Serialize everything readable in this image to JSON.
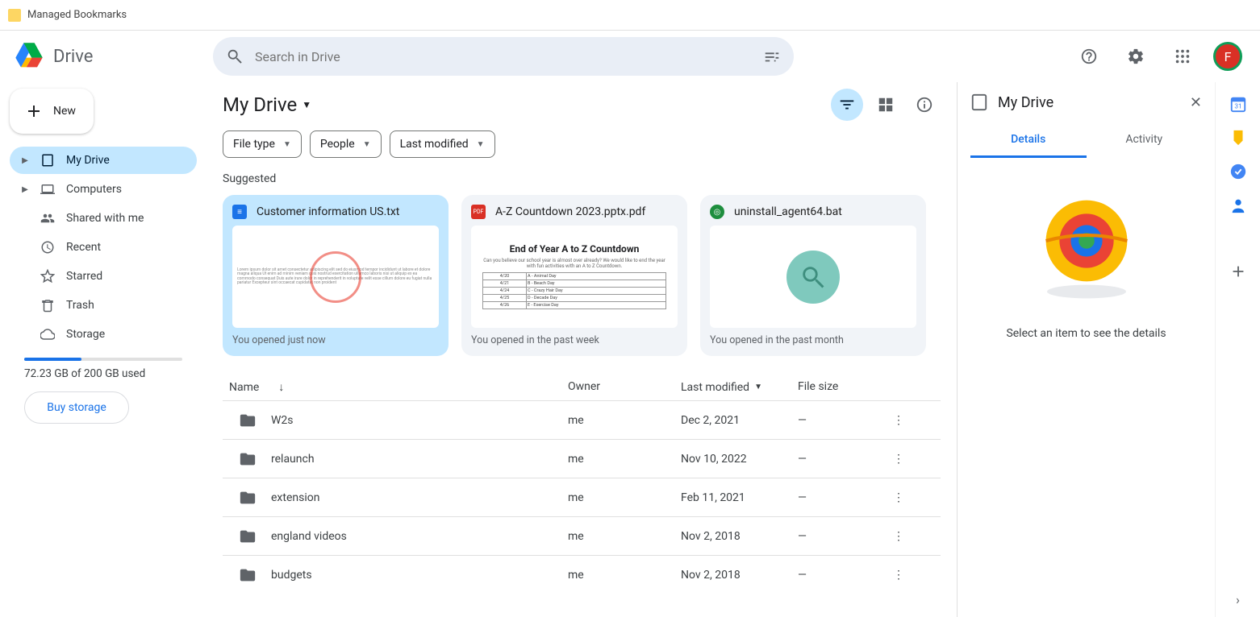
{
  "bookmark_bar": {
    "label": "Managed Bookmarks"
  },
  "app": {
    "name": "Drive"
  },
  "search": {
    "placeholder": "Search in Drive"
  },
  "avatar": {
    "letter": "F"
  },
  "sidebar": {
    "new_label": "New",
    "items": [
      {
        "label": "My Drive",
        "expandable": true
      },
      {
        "label": "Computers",
        "expandable": true
      },
      {
        "label": "Shared with me"
      },
      {
        "label": "Recent"
      },
      {
        "label": "Starred"
      },
      {
        "label": "Trash"
      },
      {
        "label": "Storage"
      }
    ],
    "storage_used_text": "72.23 GB of 200 GB used",
    "storage_pct": 36,
    "buy_label": "Buy storage"
  },
  "breadcrumb": {
    "title": "My Drive"
  },
  "filters": {
    "chips": [
      "File type",
      "People",
      "Last modified"
    ]
  },
  "suggested": {
    "title": "Suggested",
    "cards": [
      {
        "title": "Customer information US.txt",
        "subtitle": "You opened just now",
        "icon_color": "#1a73e8",
        "icon_text": "≡",
        "selected": true,
        "thumb": "text"
      },
      {
        "title": "A-Z Countdown 2023.pptx.pdf",
        "subtitle": "You opened in the past week",
        "icon_color": "#d93025",
        "icon_text": "PDF",
        "thumb": "az"
      },
      {
        "title": "uninstall_agent64.bat",
        "subtitle": "You opened in the past month",
        "icon_color": "#1e8e3e",
        "icon_text": "◎",
        "thumb": "magnify"
      }
    ]
  },
  "table": {
    "columns": {
      "name": "Name",
      "owner": "Owner",
      "modified": "Last modified",
      "size": "File size"
    },
    "rows": [
      {
        "name": "W2s",
        "owner": "me",
        "modified": "Dec 2, 2021",
        "size": "—"
      },
      {
        "name": "relaunch",
        "owner": "me",
        "modified": "Nov 10, 2022",
        "size": "—"
      },
      {
        "name": "extension",
        "owner": "me",
        "modified": "Feb 11, 2021",
        "size": "—"
      },
      {
        "name": "england videos",
        "owner": "me",
        "modified": "Nov 2, 2018",
        "size": "—"
      },
      {
        "name": "budgets",
        "owner": "me",
        "modified": "Nov 2, 2018",
        "size": "—"
      }
    ]
  },
  "details": {
    "title": "My Drive",
    "tabs": {
      "details": "Details",
      "activity": "Activity"
    },
    "empty_msg": "Select an item to see the details"
  }
}
